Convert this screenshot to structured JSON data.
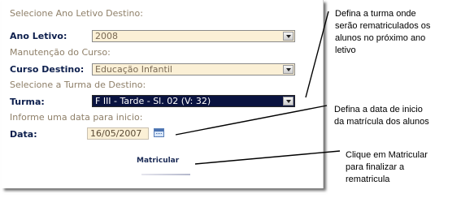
{
  "form": {
    "section_year": "Selecione Ano Letivo Destino:",
    "year_label": "Ano Letivo:",
    "year_value": "2008",
    "section_course": "Manutenção do Curso:",
    "course_label": "Curso Destino:",
    "course_value": "Educação Infantil",
    "section_class": "Selecione a Turma de Destino:",
    "class_label": "Turma:",
    "class_value": "F III - Tarde - Sl. 02 (V: 32)",
    "section_date": "Informe uma data para inicio:",
    "date_label": "Data:",
    "date_value": "16/05/2007",
    "calendar_icon": "calendar-icon",
    "submit_label": "Matricular"
  },
  "callouts": {
    "class_note": [
      "Defina a turma onde",
      "serão rematriculados os",
      "alunos no próximo ano",
      "letivo"
    ],
    "date_note": [
      "Defina a data de inicio",
      "da matrícula dos alunos"
    ],
    "submit_note": [
      "Clique em Matricular",
      "para finalizar a",
      "rematricula"
    ]
  },
  "colors": {
    "section_text": "#8e7f68",
    "label_text": "#0d1f4d",
    "field_bg": "#fbf0d6",
    "selected_bg": "#0a1340"
  }
}
